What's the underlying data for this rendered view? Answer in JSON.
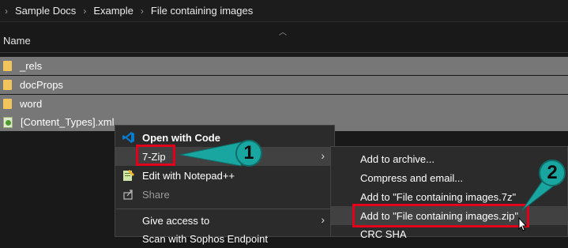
{
  "breadcrumb": [
    "Sample Docs",
    "Example",
    "File containing images"
  ],
  "header": {
    "name_col": "Name"
  },
  "files": [
    {
      "name": "_rels",
      "type": "folder"
    },
    {
      "name": "docProps",
      "type": "folder"
    },
    {
      "name": "word",
      "type": "folder"
    },
    {
      "name": "[Content_Types].xml",
      "type": "xml"
    }
  ],
  "context_menu": {
    "open_with_code": "Open with Code",
    "seven_zip": "7-Zip",
    "edit_notepad": "Edit with Notepad++",
    "share": "Share",
    "give_access": "Give access to",
    "scan_partial": "Scan with Sophos Endpoint"
  },
  "submenu": {
    "add_archive": "Add to archive...",
    "compress_email": "Compress and email...",
    "add_7z": "Add to \"File containing images.7z\"",
    "add_zip": "Add to \"File containing images.zip\"",
    "crc": "CRC SHA"
  },
  "callouts": {
    "one": "1",
    "two": "2"
  },
  "colors": {
    "callout": "#1aa6a0",
    "highlight_box": "#e3001b",
    "selection": "#777777",
    "menu_bg": "#2b2b2b"
  }
}
